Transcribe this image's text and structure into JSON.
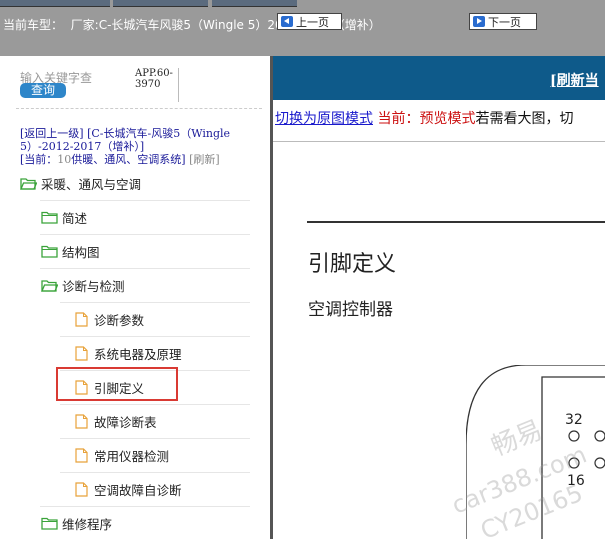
{
  "header": {
    "vehicle_label": "当前车型：",
    "vehicle_value": "厂家:C-长城汽车风骏5（Wingle 5）2012-2017（增补）"
  },
  "sidebar": {
    "search_placeholder": "输入关键字查",
    "search_button": "查询",
    "app_code_line1": "APP.60-",
    "app_code_line2": "3970",
    "back_link": "[返回上一级]",
    "breadcrumb": "[C-长城汽车-风骏5（Wingle 5）-2012-2017（增补）]",
    "current_label": "[当前：",
    "current_value": "10",
    "current_path": "供暖、通风、空调系统]",
    "refresh": "[刷新]",
    "tree": {
      "root": "采暖、通风与空调",
      "folders": [
        "简述",
        "结构图",
        "诊断与检测"
      ],
      "files": [
        "诊断参数",
        "系统电器及原理",
        "引脚定义",
        "故障诊断表",
        "常用仪器检测",
        "空调故障自诊断"
      ],
      "last_folder": "维修程序"
    }
  },
  "toolbar": {
    "prev_label": "上一页",
    "next_label": "下一页",
    "refresh_link": "[刷新当"
  },
  "mode_bar": {
    "switch_link": "切换为原图模式",
    "current_mode": "当前：预览模式",
    "hint": "若需看大图，切"
  },
  "document": {
    "title": "引脚定义",
    "subtitle": "空调控制器",
    "pin_top": "32",
    "pin_bottom": "16",
    "watermark_cn": "畅易",
    "watermark_url": "car388.com",
    "watermark_code": "CY20165"
  },
  "colors": {
    "topbar": "#9a9a9a",
    "navbar": "#0e5a8a",
    "search_button": "#2e86c9",
    "highlight": "#d93a33",
    "folder_green": "#3aa33a",
    "file_orange": "#e8a23a"
  }
}
